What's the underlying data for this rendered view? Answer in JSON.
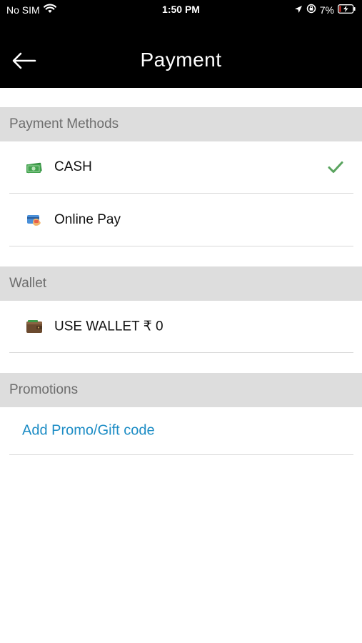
{
  "status_bar": {
    "carrier": "No SIM",
    "time": "1:50 PM",
    "battery": "7%"
  },
  "header": {
    "title": "Payment"
  },
  "payment_methods": {
    "header": "Payment Methods",
    "items": [
      {
        "label": "CASH",
        "icon": "cash-icon",
        "selected": true
      },
      {
        "label": "Online Pay",
        "icon": "card-icon",
        "selected": false
      }
    ]
  },
  "wallet": {
    "header": "Wallet",
    "label": "USE WALLET ₹ 0",
    "icon": "wallet-icon"
  },
  "promotions": {
    "header": "Promotions",
    "link": "Add Promo/Gift code"
  },
  "colors": {
    "bar_background": "#000000",
    "section_background": "#dddddd",
    "link": "#1a8bc4",
    "check": "#5aa45f"
  }
}
